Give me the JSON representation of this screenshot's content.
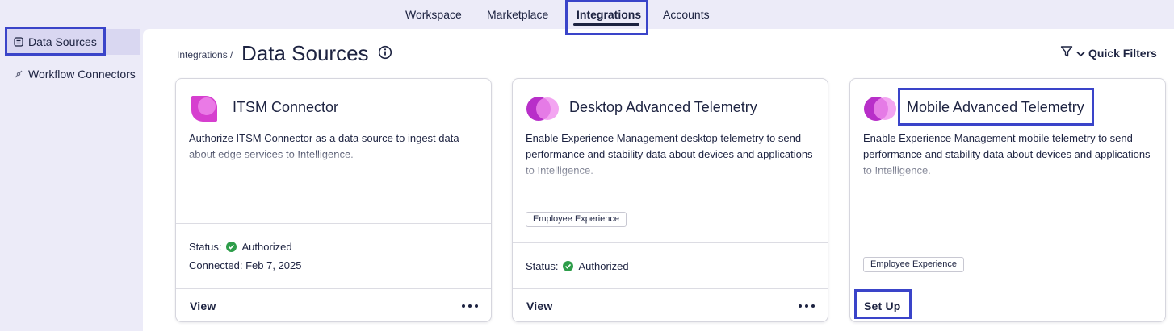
{
  "top_nav": {
    "tabs": [
      {
        "label": "Workspace"
      },
      {
        "label": "Marketplace"
      },
      {
        "label": "Integrations",
        "active": true
      },
      {
        "label": "Accounts"
      }
    ]
  },
  "sidebar": {
    "items": [
      {
        "label": "Data Sources",
        "icon": "data-sources-icon",
        "active": true
      },
      {
        "label": "Workflow Connectors",
        "icon": "connector-icon",
        "active": false
      }
    ]
  },
  "header": {
    "breadcrumb": "Integrations /",
    "title": "Data Sources",
    "info_icon": "info-icon",
    "filters_label": "Quick Filters",
    "filter_icon": "filter-icon"
  },
  "cards": [
    {
      "title": "ITSM Connector",
      "description": "Authorize ITSM Connector as a data source to ingest data about edge services to Intelligence.",
      "status_label": "Status:",
      "status_value": "Authorized",
      "connected": "Connected: Feb 7, 2025",
      "action_label": "View"
    },
    {
      "title": "Desktop Advanced Telemetry",
      "description": "Enable Experience Management desktop telemetry to send performance and stability data about devices and applications to Intelligence.",
      "tag": "Employee Experience",
      "status_label": "Status:",
      "status_value": "Authorized",
      "action_label": "View"
    },
    {
      "title": "Mobile Advanced Telemetry",
      "description": "Enable Experience Management mobile telemetry to send performance and stability data about devices and applications to Intelligence.",
      "tag": "Employee Experience",
      "action_label": "Set Up"
    }
  ],
  "colors": {
    "accent": "#3a44c9",
    "text": "#1d2341",
    "page_bg": "#ecebf8",
    "status_ok": "#2e9d4a",
    "logo_pink": "#e24fd8",
    "logo_purple": "#b82fc9"
  }
}
